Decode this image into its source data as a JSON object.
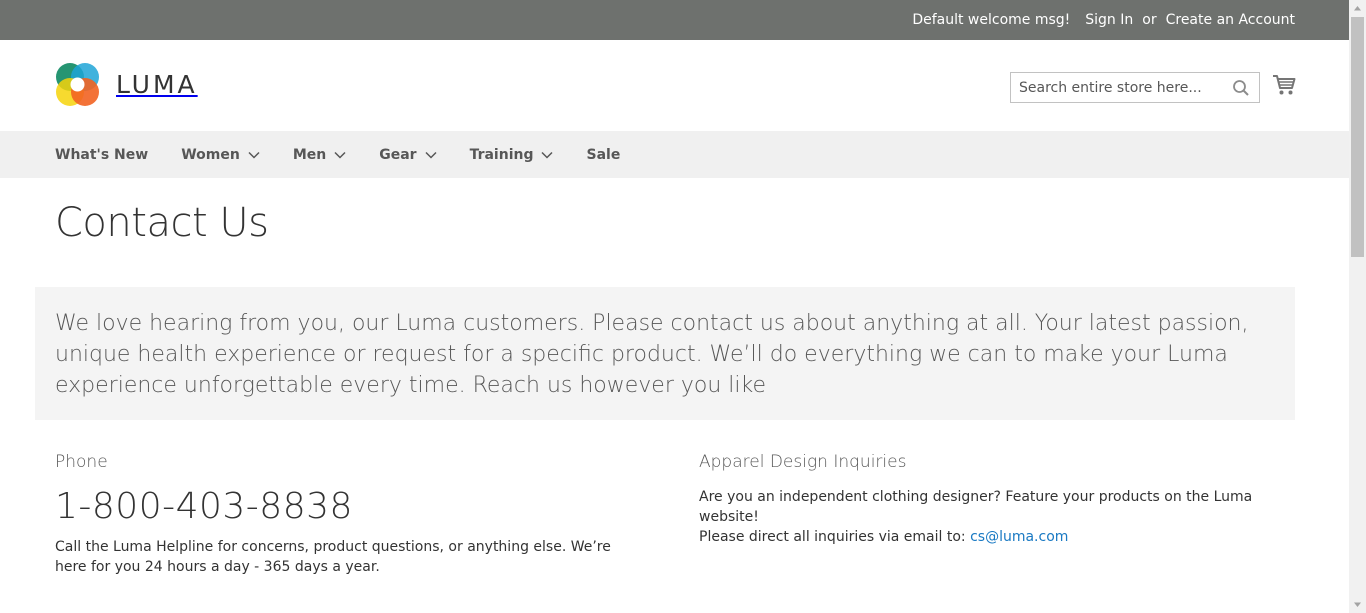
{
  "panel": {
    "welcome": "Default welcome msg!",
    "sign_in": "Sign In",
    "or": "or",
    "create_account": "Create an Account"
  },
  "header": {
    "logo_text": "LUMA",
    "search_placeholder": "Search entire store here..."
  },
  "nav": {
    "items": [
      {
        "label": "What's New",
        "has_dropdown": false
      },
      {
        "label": "Women",
        "has_dropdown": true
      },
      {
        "label": "Men",
        "has_dropdown": true
      },
      {
        "label": "Gear",
        "has_dropdown": true
      },
      {
        "label": "Training",
        "has_dropdown": true
      },
      {
        "label": "Sale",
        "has_dropdown": false
      }
    ]
  },
  "main": {
    "title": "Contact Us",
    "intro": "We love hearing from you, our Luma customers. Please contact us about anything at all. Your latest passion, unique health experience or request for a specific product. We’ll do everything we can to make your Luma experience unforgettable every time. Reach us however you like",
    "phone": {
      "heading": "Phone",
      "number": "1-800-403-8838",
      "text": "Call the Luma Helpline for concerns, product questions, or anything else. We’re here for you 24 hours a day - 365 days a year."
    },
    "apparel": {
      "heading": "Apparel Design Inquiries",
      "text_line1": "Are you an independent clothing designer? Feature your products on the Luma website!",
      "text_line2_prefix": "Please direct all inquiries via email to: ",
      "email": "cs@luma.com"
    }
  },
  "colors": {
    "panel_bg": "#6e716e",
    "nav_bg": "#f0f0f0",
    "link": "#1979c3"
  }
}
